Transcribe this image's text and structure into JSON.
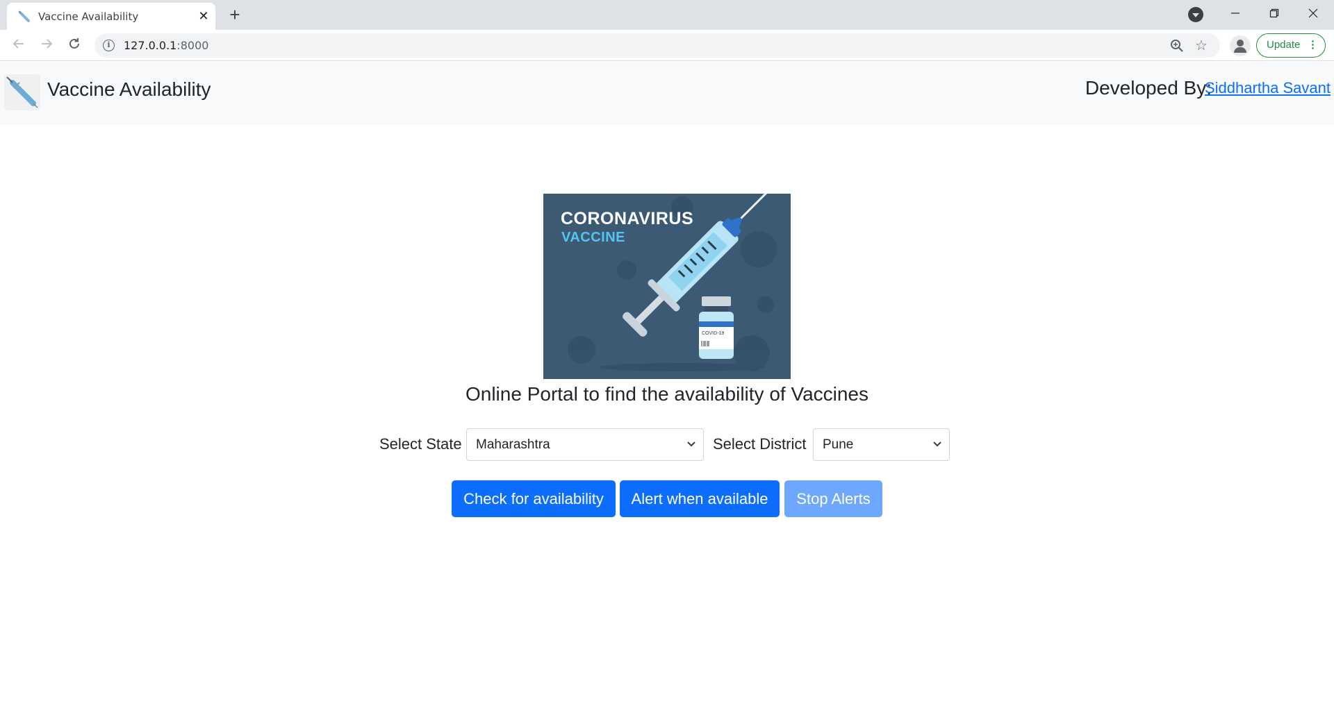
{
  "browser": {
    "tab_title": "Vaccine Availability",
    "tab_close": "✕",
    "new_tab": "+",
    "url_host": "127.0.0.1",
    "url_port": ":8000",
    "update_label": "Update"
  },
  "navbar": {
    "brand": "Vaccine Availability",
    "developed_by_label": "Developed By:",
    "developer_name": "Siddhartha Savant"
  },
  "hero": {
    "title_line1": "CORONAVIRUS",
    "title_line2": "VACCINE",
    "vial_label": "COVID-19",
    "bg_color": "#3d5a75"
  },
  "main": {
    "tagline": "Online Portal to find the availability of Vaccines",
    "state_label": "Select State",
    "state_value": "Maharashtra",
    "district_label": "Select District",
    "district_value": "Pune"
  },
  "buttons": {
    "check": "Check for availability",
    "alert": "Alert when available",
    "stop": "Stop Alerts"
  },
  "colors": {
    "primary": "#0d6efd",
    "primary_disabled": "#6ea8fe",
    "link": "#0d6efd",
    "navbar_bg": "#f8f9fa"
  }
}
